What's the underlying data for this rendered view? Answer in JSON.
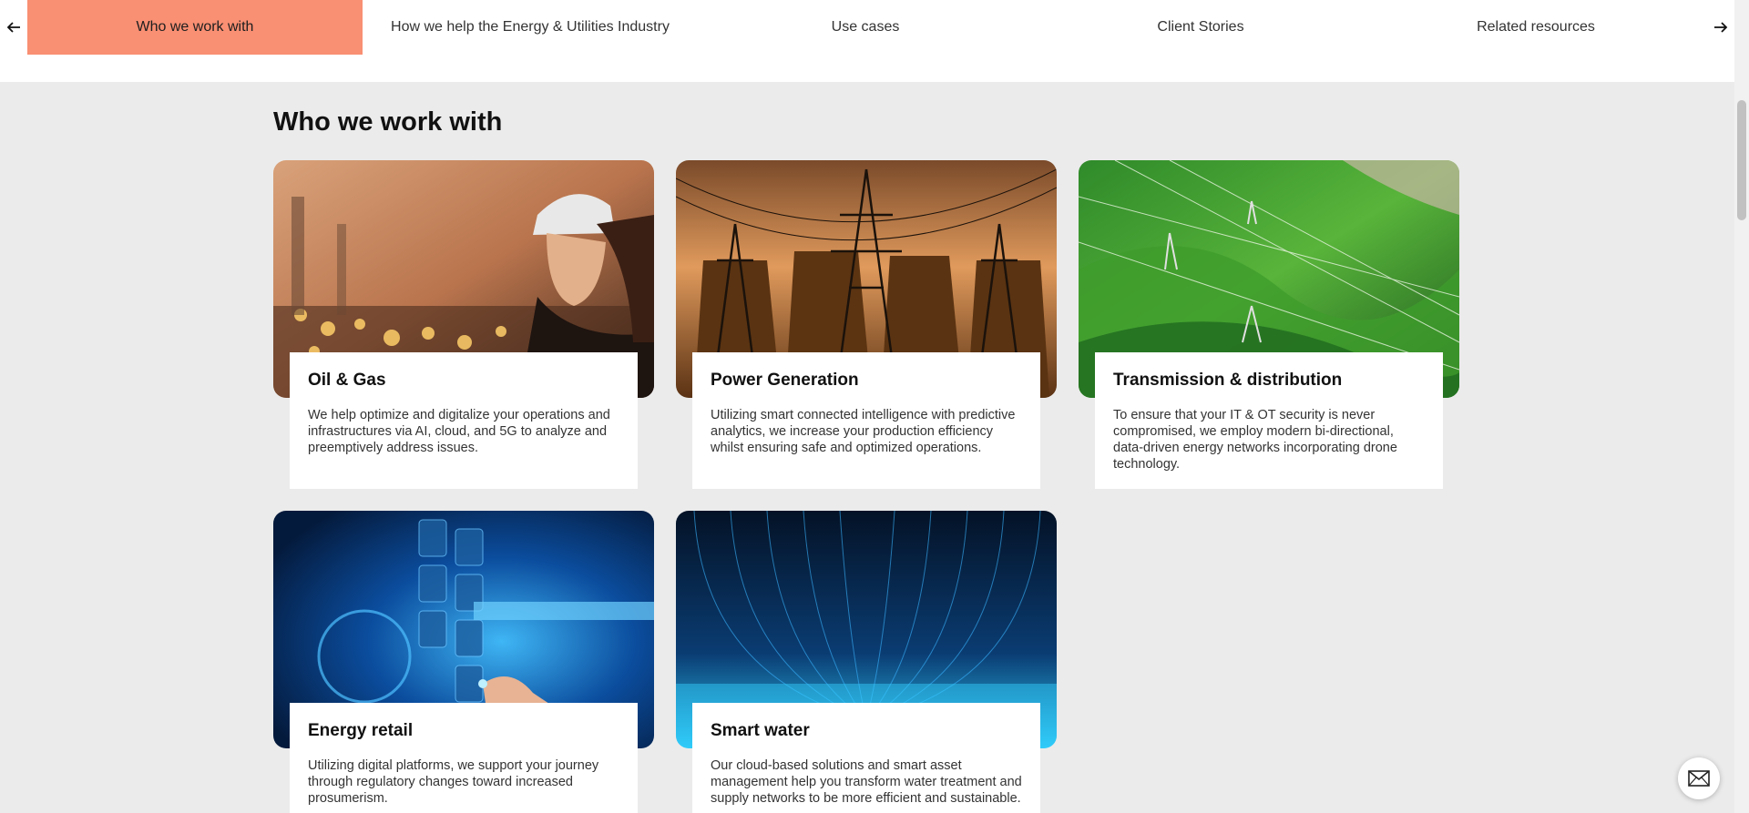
{
  "nav": {
    "prev_icon": "arrow-left-icon",
    "next_icon": "arrow-right-icon",
    "tabs": [
      {
        "label": "Who we work with",
        "active": true
      },
      {
        "label": "How we help the Energy & Utilities Industry",
        "active": false
      },
      {
        "label": "Use cases",
        "active": false
      },
      {
        "label": "Client Stories",
        "active": false
      },
      {
        "label": "Related resources",
        "active": false
      }
    ]
  },
  "section": {
    "title": "Who we work with",
    "cards": [
      {
        "title": "Oil & Gas",
        "description": "We help optimize and digitalize your operations and infrastructures via AI, cloud, and 5G to analyze and preemptively address issues.",
        "image": "engineer-refinery-photo"
      },
      {
        "title": "Power Generation",
        "description": "Utilizing smart connected intelligence with predictive analytics, we increase your production efficiency whilst ensuring safe and optimized operations.",
        "image": "power-pylons-sunset-photo"
      },
      {
        "title": "Transmission & distribution",
        "description": "To ensure that your IT & OT security is never compromised, we employ modern bi-directional, data-driven energy networks incorporating drone technology.",
        "image": "green-hills-power-lines-photo"
      },
      {
        "title": "Energy retail",
        "description": "Utilizing digital platforms, we support your journey through regulatory changes toward increased prosumerism.",
        "image": "digital-interface-hand-photo"
      },
      {
        "title": "Smart water",
        "description": "Our cloud-based solutions and smart asset management help you transform water treatment and supply networks to be more efficient and sustainable.",
        "image": "blue-data-streams-photo"
      }
    ]
  },
  "chat": {
    "icon": "envelope-icon"
  },
  "colors": {
    "accent": "#f98f73",
    "background": "#ebebeb"
  }
}
